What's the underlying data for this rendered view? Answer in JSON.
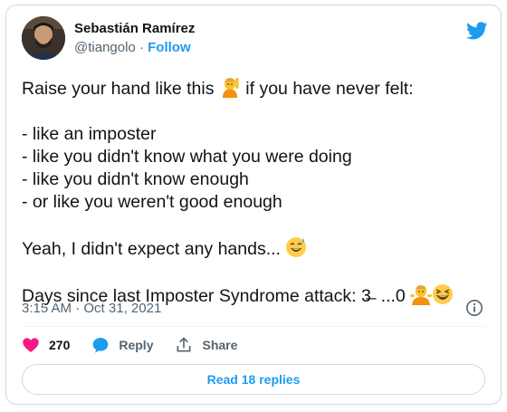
{
  "author": {
    "name": "Sebastián Ramírez",
    "handle": "@tiangolo",
    "separator": "·",
    "follow_label": "Follow"
  },
  "tweet": {
    "line1_before": "Raise your hand like this ",
    "line1_after": " if you have never felt:",
    "list": [
      "- like an imposter",
      "- like you didn't know what you were doing",
      "- like you didn't know enough",
      "- or like you weren't good enough"
    ],
    "line_hands": "Yeah, I didn't expect any hands... ",
    "line_days": "Days since last Imposter Syndrome attack: 3̶  ...0 ",
    "emojis": [
      "raising-hand-emoji",
      "sweat-smile-emoji",
      "shrug-person-emoji",
      "laughing-emoji"
    ]
  },
  "meta": {
    "time": "3:15 AM",
    "separator": "·",
    "date": "Oct 31, 2021"
  },
  "actions": {
    "likes": "270",
    "reply_label": "Reply",
    "share_label": "Share"
  },
  "read_replies": "Read 18 replies",
  "colors": {
    "accent": "#1d9bf0",
    "like": "#f91880",
    "muted": "#536471",
    "border": "#cfd9de"
  }
}
